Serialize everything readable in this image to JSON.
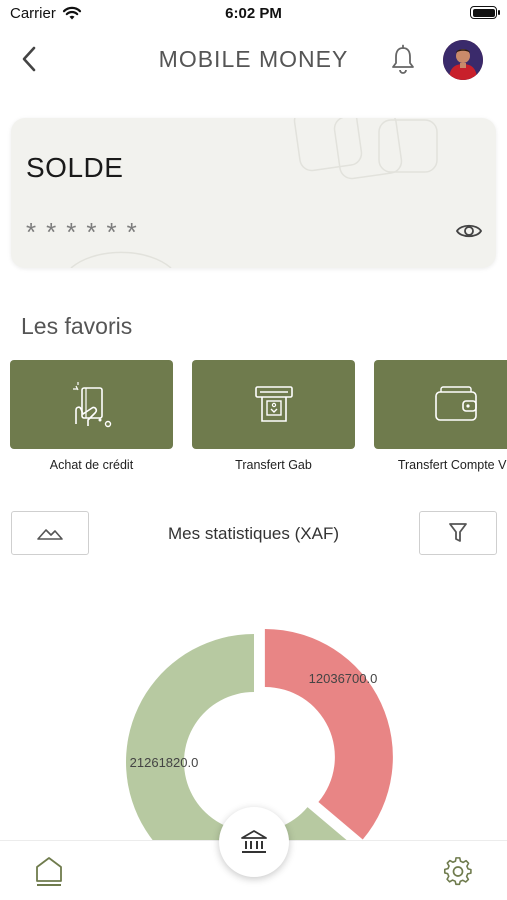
{
  "status_bar": {
    "carrier": "Carrier",
    "time": "6:02 PM"
  },
  "header": {
    "title": "MOBILE MONEY"
  },
  "balance": {
    "label": "SOLDE",
    "masked_value": "******"
  },
  "favorites": {
    "title": "Les favoris",
    "items": [
      {
        "label": "Achat de crédit",
        "icon": "phone-credit-icon"
      },
      {
        "label": "Transfert Gab",
        "icon": "atm-icon"
      },
      {
        "label": "Transfert Compte Vir",
        "icon": "wallet-icon"
      }
    ]
  },
  "stats": {
    "title": "Mes statistiques (XAF)"
  },
  "chart_data": {
    "type": "pie",
    "donut": true,
    "series": [
      {
        "value": 12036700.0,
        "label": "12036700.0",
        "color": "#e88585"
      },
      {
        "value": 21261820.0,
        "label": "21261820.0",
        "color": "#b7c9a1"
      }
    ]
  },
  "colors": {
    "accent": "#6f7b4d",
    "card_bg": "#f2f2ee"
  }
}
